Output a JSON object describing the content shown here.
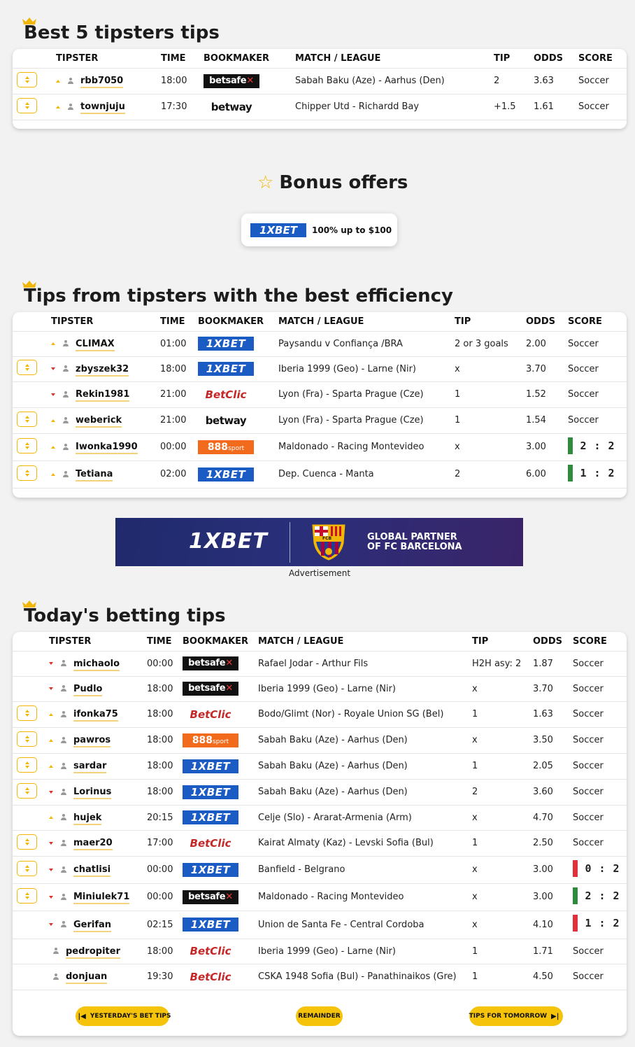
{
  "best5": {
    "title": "Best 5 tipsters tips",
    "headers": {
      "tipster": "TIPSTER",
      "time": "TIME",
      "bookmaker": "BOOKMAKER",
      "match": "MATCH / LEAGUE",
      "tip": "TIP",
      "odds": "ODDS",
      "score": "SCORE"
    },
    "rows": [
      {
        "tipster": "rbb7050",
        "time": "18:00",
        "bookmaker": "betsafe",
        "match": "Sabah Baku (Aze) - Aarhus (Den)",
        "tip": "2",
        "odds": "3.63",
        "score": "Soccer"
      },
      {
        "tipster": "townjuju",
        "time": "17:30",
        "bookmaker": "betway",
        "match": "Chipper Utd - Richardd Bay",
        "tip": "+1.5",
        "odds": "1.61",
        "score": "Soccer"
      }
    ]
  },
  "bonus": {
    "title": "Bonus offers",
    "offer_brand": "1XBET",
    "offer_text": "100% up to $100"
  },
  "efficiency": {
    "title": "Tips from tipsters with the best efficiency",
    "headers": {
      "tipster": "TIPSTER",
      "time": "TIME",
      "bookmaker": "BOOKMAKER",
      "match": "MATCH / LEAGUE",
      "tip": "TIP",
      "odds": "ODDS",
      "score": "SCORE"
    },
    "rows": [
      {
        "tipster": "CLIMAX",
        "time": "01:00",
        "bookmaker": "1XBET",
        "match": "Paysandu v Confiança /BRA",
        "tip": "2 or 3 goals",
        "odds": "2.00",
        "score": "Soccer"
      },
      {
        "tipster": "zbyszek32",
        "time": "18:00",
        "bookmaker": "1XBET",
        "match": "Iberia 1999 (Geo) - Larne (Nir)",
        "tip": "x",
        "odds": "3.70",
        "score": "Soccer"
      },
      {
        "tipster": "Rekin1981",
        "time": "21:00",
        "bookmaker": "BetClic",
        "match": "Lyon (Fra) - Sparta Prague (Cze)",
        "tip": "1",
        "odds": "1.52",
        "score": "Soccer"
      },
      {
        "tipster": "weberick",
        "time": "21:00",
        "bookmaker": "betway",
        "match": "Lyon (Fra) - Sparta Prague (Cze)",
        "tip": "1",
        "odds": "1.54",
        "score": "Soccer"
      },
      {
        "tipster": "Iwonka1990",
        "time": "00:00",
        "bookmaker": "888sport",
        "match": "Maldonado - Racing Montevideo",
        "tip": "x",
        "odds": "3.00",
        "score_home": "2",
        "score_away": "2",
        "score_sep": ":"
      },
      {
        "tipster": "Tetiana",
        "time": "02:00",
        "bookmaker": "1XBET",
        "match": "Dep. Cuenca - Manta",
        "tip": "2",
        "odds": "6.00",
        "score_home": "1",
        "score_away": "2",
        "score_sep": ":"
      }
    ]
  },
  "ad": {
    "brand": "1XBET",
    "partner_line1": "GLOBAL PARTNER",
    "partner_line2": "OF FC BARCELONA",
    "crest_text": "FCB",
    "label": "Advertisement"
  },
  "today": {
    "title": "Today's betting tips",
    "headers": {
      "tipster": "TIPSTER",
      "time": "TIME",
      "bookmaker": "BOOKMAKER",
      "match": "MATCH / LEAGUE",
      "tip": "TIP",
      "odds": "ODDS",
      "score": "SCORE"
    },
    "rows": [
      {
        "tipster": "michaolo",
        "time": "00:00",
        "bookmaker": "betsafe",
        "match": "Rafael Jodar - Arthur Fils",
        "tip": "H2H asy: 2",
        "odds": "1.87",
        "score": "Soccer"
      },
      {
        "tipster": "Pudlo",
        "time": "18:00",
        "bookmaker": "betsafe",
        "match": "Iberia 1999 (Geo) - Larne (Nir)",
        "tip": "x",
        "odds": "3.70",
        "score": "Soccer"
      },
      {
        "tipster": "ifonka75",
        "time": "18:00",
        "bookmaker": "BetClic",
        "match": "Bodo/Glimt (Nor) - Royale Union SG (Bel)",
        "tip": "1",
        "odds": "1.63",
        "score": "Soccer"
      },
      {
        "tipster": "pawros",
        "time": "18:00",
        "bookmaker": "888sport",
        "match": "Sabah Baku (Aze) - Aarhus (Den)",
        "tip": "x",
        "odds": "3.50",
        "score": "Soccer"
      },
      {
        "tipster": "sardar",
        "time": "18:00",
        "bookmaker": "1XBET",
        "match": "Sabah Baku (Aze) - Aarhus (Den)",
        "tip": "1",
        "odds": "2.05",
        "score": "Soccer"
      },
      {
        "tipster": "Lorinus",
        "time": "18:00",
        "bookmaker": "1XBET",
        "match": "Sabah Baku (Aze) - Aarhus (Den)",
        "tip": "2",
        "odds": "3.60",
        "score": "Soccer"
      },
      {
        "tipster": "hujek",
        "time": "20:15",
        "bookmaker": "1XBET",
        "match": "Celje (Slo) - Ararat-Armenia (Arm)",
        "tip": "x",
        "odds": "4.70",
        "score": "Soccer"
      },
      {
        "tipster": "maer20",
        "time": "17:00",
        "bookmaker": "BetClic",
        "match": "Kairat Almaty (Kaz) - Levski Sofia (Bul)",
        "tip": "1",
        "odds": "2.50",
        "score": "Soccer"
      },
      {
        "tipster": "chatlisi",
        "time": "00:00",
        "bookmaker": "1XBET",
        "match": "Banfield - Belgrano",
        "tip": "x",
        "odds": "3.00",
        "score_home": "0",
        "score_away": "2",
        "score_sep": ":"
      },
      {
        "tipster": "Miniulek71",
        "time": "00:00",
        "bookmaker": "betsafe",
        "match": "Maldonado - Racing Montevideo",
        "tip": "x",
        "odds": "3.00",
        "score_home": "2",
        "score_away": "2",
        "score_sep": ":"
      },
      {
        "tipster": "Gerifan",
        "time": "02:15",
        "bookmaker": "1XBET",
        "match": "Union de Santa Fe - Central Cordoba",
        "tip": "x",
        "odds": "4.10",
        "score_home": "1",
        "score_away": "2",
        "score_sep": ":"
      },
      {
        "tipster": "pedropiter",
        "time": "18:00",
        "bookmaker": "BetClic",
        "match": "Iberia 1999 (Geo) - Larne (Nir)",
        "tip": "1",
        "odds": "1.71",
        "score": "Soccer"
      },
      {
        "tipster": "donjuan",
        "time": "19:30",
        "bookmaker": "BetClic",
        "match": "CSKA 1948 Sofia (Bul) - Panathinaikos (Gre)",
        "tip": "1",
        "odds": "4.50",
        "score": "Soccer"
      }
    ],
    "buttons": {
      "yesterday": "YESTERDAY'S BET TIPS",
      "remainder": "REMAINDER",
      "tomorrow": "TIPS FOR TOMORROW"
    }
  },
  "colors": {
    "accent": "#f5c30a",
    "win": "#2e8b3e",
    "loss": "#e0303c",
    "onexbet": "#1a5bc4"
  },
  "icons": [
    "crown-icon",
    "star-icon",
    "user-icon",
    "expand-icon",
    "trend-up-icon",
    "trend-down-icon",
    "first-page-icon",
    "last-page-icon"
  ]
}
